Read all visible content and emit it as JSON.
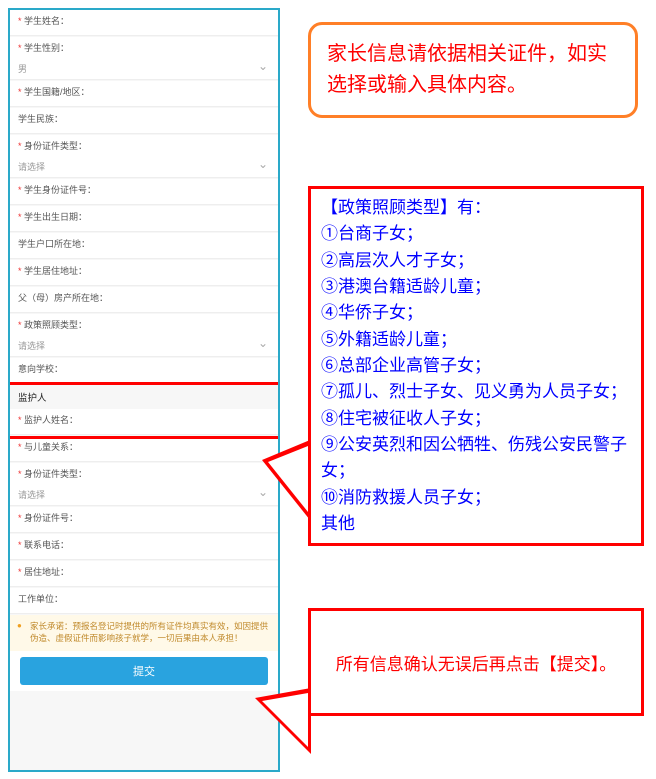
{
  "form": {
    "fields": [
      {
        "label": "学生姓名：",
        "required": true,
        "type": "text",
        "value": ""
      },
      {
        "label": "学生性别：",
        "required": true,
        "type": "select",
        "value": "男"
      },
      {
        "label": "学生国籍/地区：",
        "required": true,
        "type": "text",
        "value": ""
      },
      {
        "label": "学生民族：",
        "required": false,
        "type": "text",
        "value": ""
      },
      {
        "label": "身份证件类型：",
        "required": true,
        "type": "select",
        "value": "请选择"
      },
      {
        "label": "学生身份证件号：",
        "required": true,
        "type": "text",
        "value": ""
      },
      {
        "label": "学生出生日期：",
        "required": true,
        "type": "text",
        "value": ""
      },
      {
        "label": "学生户口所在地：",
        "required": false,
        "type": "text",
        "value": ""
      },
      {
        "label": "学生居住地址：",
        "required": true,
        "type": "text",
        "value": ""
      },
      {
        "label": "父（母）房产所在地：",
        "required": false,
        "type": "text",
        "value": ""
      },
      {
        "label": "政策照顾类型：",
        "required": true,
        "type": "select",
        "value": "请选择"
      },
      {
        "label": "意向学校：",
        "required": false,
        "type": "text",
        "value": ""
      }
    ],
    "guardian": {
      "section_title": "监护人",
      "name_label": "监护人姓名："
    },
    "guardian_fields": [
      {
        "label": "与儿童关系：",
        "required": true,
        "type": "text",
        "value": ""
      },
      {
        "label": "身份证件类型：",
        "required": true,
        "type": "select",
        "value": "请选择"
      },
      {
        "label": "身份证件号：",
        "required": true,
        "type": "text",
        "value": ""
      },
      {
        "label": "联系电话：",
        "required": true,
        "type": "text",
        "value": ""
      },
      {
        "label": "居住地址：",
        "required": true,
        "type": "text",
        "value": ""
      },
      {
        "label": "工作单位：",
        "required": false,
        "type": "text",
        "value": ""
      }
    ],
    "declaration": "家长承诺：预报名登记时提供的所有证件均真实有效，如因提供伪造、虚假证件而影响孩子就学，一切后果由本人承担！",
    "submit_label": "提交"
  },
  "callouts": {
    "orange": "家长信息请依据相关证件，如实选择或输入具体内容。",
    "policy_title": "【政策照顾类型】有：",
    "policy_items": [
      "①台商子女；",
      "②高层次人才子女；",
      "③港澳台籍适龄儿童；",
      "④华侨子女；",
      "⑤外籍适龄儿童；",
      "⑥总部企业高管子女；",
      "⑦孤儿、烈士子女、见义勇为人员子女；",
      "⑧住宅被征收人子女；",
      "⑨公安英烈和因公牺牲、伤残公安民警子女；",
      "⑩消防救援人员子女；",
      "其他"
    ],
    "confirm": "所有信息确认无误后再点击【提交】。"
  }
}
